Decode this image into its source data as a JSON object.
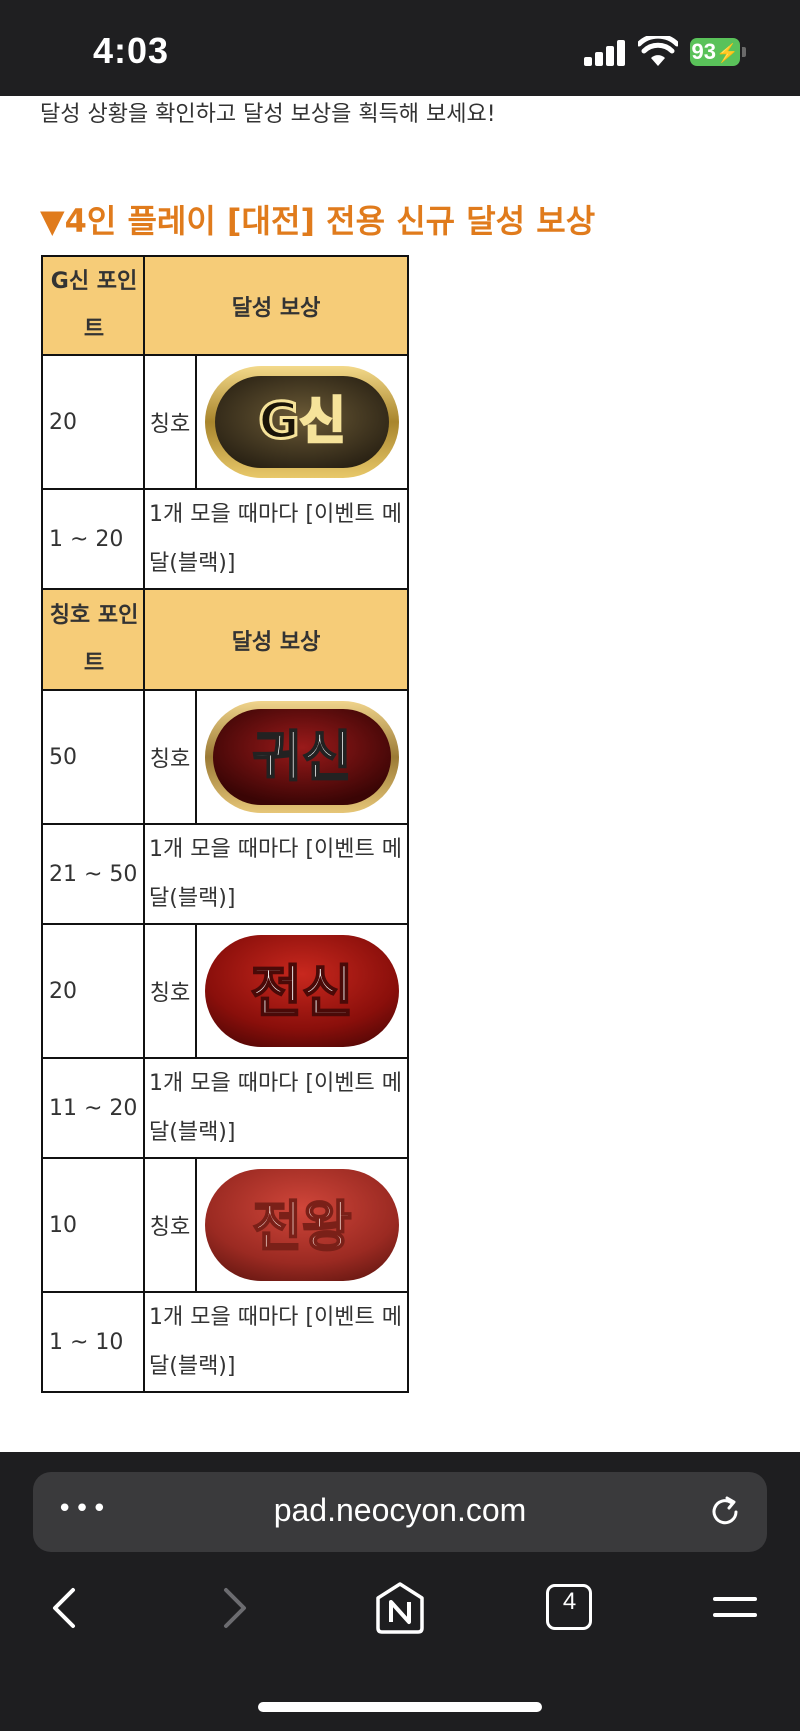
{
  "status_bar": {
    "time": "4:03",
    "battery": "93"
  },
  "page": {
    "intro": "달성 상황을 확인하고 달성 보상을 획득해 보세요!",
    "heading": "▼4인 플레이 [대전] 전용 신규 달성 보상"
  },
  "table": {
    "header1": {
      "points": "G신 포인트",
      "reward": "달성 보상"
    },
    "header2": {
      "points": "칭호 포인트",
      "reward": "달성 보상"
    },
    "rows": [
      {
        "points": "20",
        "label": "칭호",
        "badge_text": "G신"
      },
      {
        "points": "1 ~ 20",
        "desc": "1개 모을 때마다 [이벤트 메달(블랙)]"
      },
      {
        "points": "50",
        "label": "칭호",
        "badge_text": "귀신"
      },
      {
        "points": "21 ~ 50",
        "desc": "1개 모을 때마다 [이벤트 메달(블랙)]"
      },
      {
        "points": "20",
        "label": "칭호",
        "badge_text": "전신"
      },
      {
        "points": "11 ~ 20",
        "desc": "1개 모을 때마다 [이벤트 메달(블랙)]"
      },
      {
        "points": "10",
        "label": "칭호",
        "badge_text": "전왕"
      },
      {
        "points": "1 ~ 10",
        "desc": "1개 모을 때마다 [이벤트 메달(블랙)]"
      }
    ]
  },
  "browser": {
    "url": "pad.neocyon.com",
    "tab_count": "4",
    "more_label": "•••"
  },
  "colors": {
    "heading": "#e07b1c",
    "header_bg": "#f6cc78",
    "battery": "#5ac25a"
  }
}
